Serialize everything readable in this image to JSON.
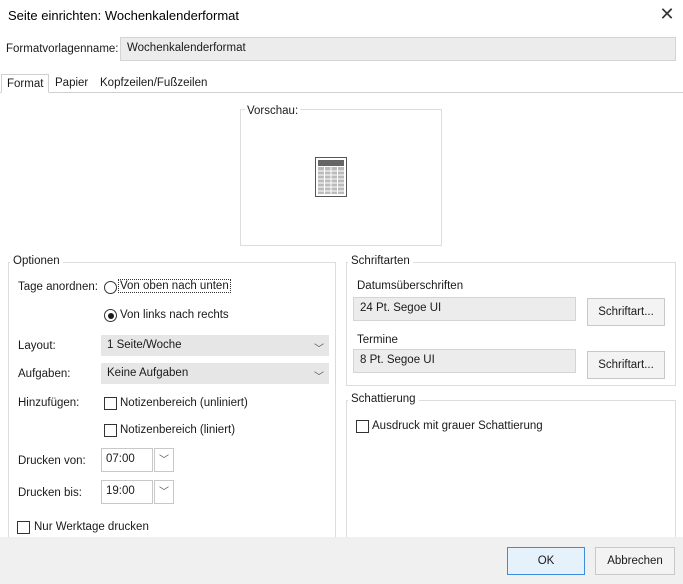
{
  "window": {
    "title": "Seite einrichten: Wochenkalenderformat",
    "close_glyph": "✕"
  },
  "style_name": {
    "label": "Formatvorlagenname:",
    "value": "Wochenkalenderformat"
  },
  "tabs": [
    {
      "label": "Format",
      "active": true
    },
    {
      "label": "Papier",
      "active": false
    },
    {
      "label": "Kopfzeilen/Fußzeilen",
      "active": false
    }
  ],
  "preview": {
    "label": "Vorschau:"
  },
  "options": {
    "title": "Optionen",
    "arrange_label": "Tage anordnen:",
    "arrange_options": [
      {
        "label": "Von oben nach unten",
        "selected": false
      },
      {
        "label": "Von links nach rechts",
        "selected": true
      }
    ],
    "layout_label": "Layout:",
    "layout_value": "1 Seite/Woche",
    "tasks_label": "Aufgaben:",
    "tasks_value": "Keine Aufgaben",
    "add_label": "Hinzufügen:",
    "add_options": [
      {
        "label": "Notizenbereich (unliniert)",
        "checked": false
      },
      {
        "label": "Notizenbereich (liniert)",
        "checked": false
      }
    ],
    "print_from_label": "Drucken von:",
    "print_from_value": "07:00",
    "print_to_label": "Drucken bis:",
    "print_to_value": "19:00",
    "workdays_label": "Nur Werktage drucken",
    "workdays_checked": false
  },
  "fonts": {
    "title": "Schriftarten",
    "date_headings_label": "Datumsüberschriften",
    "date_headings_value": "24 Pt. Segoe UI",
    "appointments_label": "Termine",
    "appointments_value": "8 Pt. Segoe UI",
    "font_button_label": "Schriftart..."
  },
  "shading": {
    "title": "Schattierung",
    "gray_label": "Ausdruck mit grauer Schattierung",
    "gray_checked": false
  },
  "footer": {
    "ok_label": "OK",
    "cancel_label": "Abbrechen"
  },
  "icons": {
    "close": "close-icon",
    "chevron": "chevron-down-icon",
    "preview": "calendar-page-preview-icon"
  },
  "colors": {
    "primary_button_border": "#3c8ce0",
    "primary_button_bg": "#e5f1fb",
    "readonly_bg": "#ececec",
    "combo_bg": "#e6e6e6"
  }
}
